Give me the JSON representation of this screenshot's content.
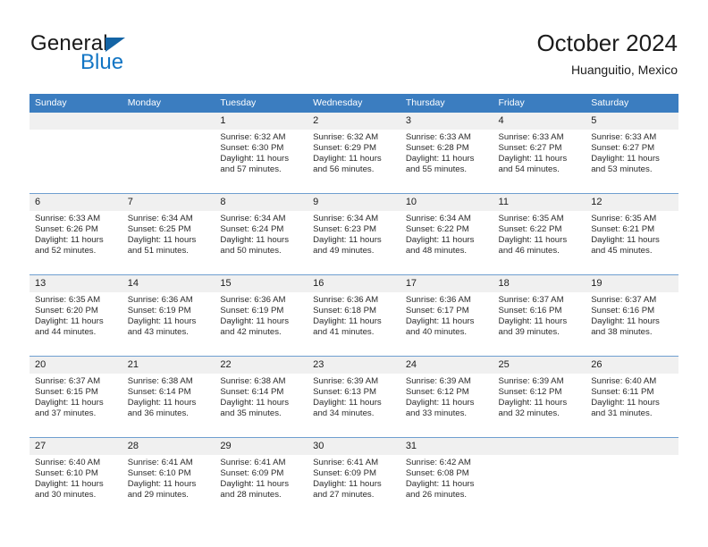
{
  "brand": {
    "name_top": "General",
    "name_bottom": "Blue",
    "triangle_color": "#1464a5",
    "blue_color": "#1275c4"
  },
  "header": {
    "title": "October 2024",
    "subtitle": "Huanguitio, Mexico"
  },
  "colors": {
    "header_row_bg": "#3b7dc0",
    "daynum_bg": "#f0f0f0",
    "row_separator": "#6f9fd0",
    "text": "#2b2b2b"
  },
  "weekday_headers": [
    "Sunday",
    "Monday",
    "Tuesday",
    "Wednesday",
    "Thursday",
    "Friday",
    "Saturday"
  ],
  "weeks": [
    [
      {
        "day": "",
        "lines": []
      },
      {
        "day": "",
        "lines": []
      },
      {
        "day": "1",
        "lines": [
          "Sunrise: 6:32 AM",
          "Sunset: 6:30 PM",
          "Daylight: 11 hours",
          "and 57 minutes."
        ]
      },
      {
        "day": "2",
        "lines": [
          "Sunrise: 6:32 AM",
          "Sunset: 6:29 PM",
          "Daylight: 11 hours",
          "and 56 minutes."
        ]
      },
      {
        "day": "3",
        "lines": [
          "Sunrise: 6:33 AM",
          "Sunset: 6:28 PM",
          "Daylight: 11 hours",
          "and 55 minutes."
        ]
      },
      {
        "day": "4",
        "lines": [
          "Sunrise: 6:33 AM",
          "Sunset: 6:27 PM",
          "Daylight: 11 hours",
          "and 54 minutes."
        ]
      },
      {
        "day": "5",
        "lines": [
          "Sunrise: 6:33 AM",
          "Sunset: 6:27 PM",
          "Daylight: 11 hours",
          "and 53 minutes."
        ]
      }
    ],
    [
      {
        "day": "6",
        "lines": [
          "Sunrise: 6:33 AM",
          "Sunset: 6:26 PM",
          "Daylight: 11 hours",
          "and 52 minutes."
        ]
      },
      {
        "day": "7",
        "lines": [
          "Sunrise: 6:34 AM",
          "Sunset: 6:25 PM",
          "Daylight: 11 hours",
          "and 51 minutes."
        ]
      },
      {
        "day": "8",
        "lines": [
          "Sunrise: 6:34 AM",
          "Sunset: 6:24 PM",
          "Daylight: 11 hours",
          "and 50 minutes."
        ]
      },
      {
        "day": "9",
        "lines": [
          "Sunrise: 6:34 AM",
          "Sunset: 6:23 PM",
          "Daylight: 11 hours",
          "and 49 minutes."
        ]
      },
      {
        "day": "10",
        "lines": [
          "Sunrise: 6:34 AM",
          "Sunset: 6:22 PM",
          "Daylight: 11 hours",
          "and 48 minutes."
        ]
      },
      {
        "day": "11",
        "lines": [
          "Sunrise: 6:35 AM",
          "Sunset: 6:22 PM",
          "Daylight: 11 hours",
          "and 46 minutes."
        ]
      },
      {
        "day": "12",
        "lines": [
          "Sunrise: 6:35 AM",
          "Sunset: 6:21 PM",
          "Daylight: 11 hours",
          "and 45 minutes."
        ]
      }
    ],
    [
      {
        "day": "13",
        "lines": [
          "Sunrise: 6:35 AM",
          "Sunset: 6:20 PM",
          "Daylight: 11 hours",
          "and 44 minutes."
        ]
      },
      {
        "day": "14",
        "lines": [
          "Sunrise: 6:36 AM",
          "Sunset: 6:19 PM",
          "Daylight: 11 hours",
          "and 43 minutes."
        ]
      },
      {
        "day": "15",
        "lines": [
          "Sunrise: 6:36 AM",
          "Sunset: 6:19 PM",
          "Daylight: 11 hours",
          "and 42 minutes."
        ]
      },
      {
        "day": "16",
        "lines": [
          "Sunrise: 6:36 AM",
          "Sunset: 6:18 PM",
          "Daylight: 11 hours",
          "and 41 minutes."
        ]
      },
      {
        "day": "17",
        "lines": [
          "Sunrise: 6:36 AM",
          "Sunset: 6:17 PM",
          "Daylight: 11 hours",
          "and 40 minutes."
        ]
      },
      {
        "day": "18",
        "lines": [
          "Sunrise: 6:37 AM",
          "Sunset: 6:16 PM",
          "Daylight: 11 hours",
          "and 39 minutes."
        ]
      },
      {
        "day": "19",
        "lines": [
          "Sunrise: 6:37 AM",
          "Sunset: 6:16 PM",
          "Daylight: 11 hours",
          "and 38 minutes."
        ]
      }
    ],
    [
      {
        "day": "20",
        "lines": [
          "Sunrise: 6:37 AM",
          "Sunset: 6:15 PM",
          "Daylight: 11 hours",
          "and 37 minutes."
        ]
      },
      {
        "day": "21",
        "lines": [
          "Sunrise: 6:38 AM",
          "Sunset: 6:14 PM",
          "Daylight: 11 hours",
          "and 36 minutes."
        ]
      },
      {
        "day": "22",
        "lines": [
          "Sunrise: 6:38 AM",
          "Sunset: 6:14 PM",
          "Daylight: 11 hours",
          "and 35 minutes."
        ]
      },
      {
        "day": "23",
        "lines": [
          "Sunrise: 6:39 AM",
          "Sunset: 6:13 PM",
          "Daylight: 11 hours",
          "and 34 minutes."
        ]
      },
      {
        "day": "24",
        "lines": [
          "Sunrise: 6:39 AM",
          "Sunset: 6:12 PM",
          "Daylight: 11 hours",
          "and 33 minutes."
        ]
      },
      {
        "day": "25",
        "lines": [
          "Sunrise: 6:39 AM",
          "Sunset: 6:12 PM",
          "Daylight: 11 hours",
          "and 32 minutes."
        ]
      },
      {
        "day": "26",
        "lines": [
          "Sunrise: 6:40 AM",
          "Sunset: 6:11 PM",
          "Daylight: 11 hours",
          "and 31 minutes."
        ]
      }
    ],
    [
      {
        "day": "27",
        "lines": [
          "Sunrise: 6:40 AM",
          "Sunset: 6:10 PM",
          "Daylight: 11 hours",
          "and 30 minutes."
        ]
      },
      {
        "day": "28",
        "lines": [
          "Sunrise: 6:41 AM",
          "Sunset: 6:10 PM",
          "Daylight: 11 hours",
          "and 29 minutes."
        ]
      },
      {
        "day": "29",
        "lines": [
          "Sunrise: 6:41 AM",
          "Sunset: 6:09 PM",
          "Daylight: 11 hours",
          "and 28 minutes."
        ]
      },
      {
        "day": "30",
        "lines": [
          "Sunrise: 6:41 AM",
          "Sunset: 6:09 PM",
          "Daylight: 11 hours",
          "and 27 minutes."
        ]
      },
      {
        "day": "31",
        "lines": [
          "Sunrise: 6:42 AM",
          "Sunset: 6:08 PM",
          "Daylight: 11 hours",
          "and 26 minutes."
        ]
      },
      {
        "day": "",
        "lines": []
      },
      {
        "day": "",
        "lines": []
      }
    ]
  ]
}
